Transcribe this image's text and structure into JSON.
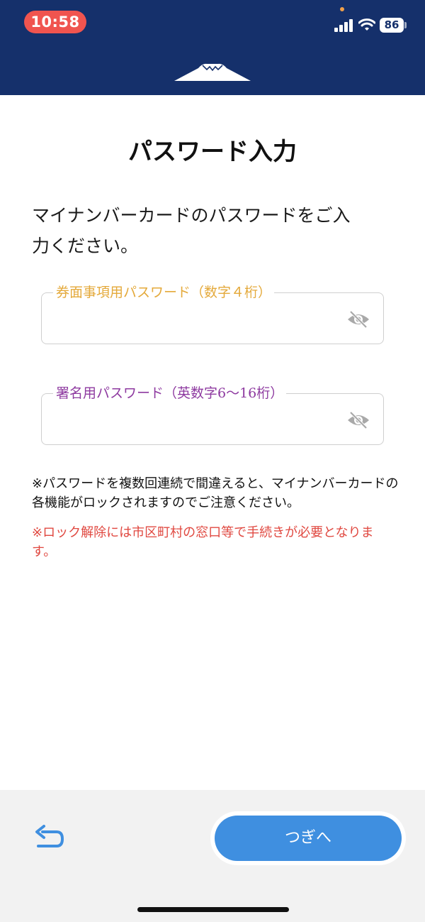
{
  "status_bar": {
    "time": "10:58",
    "battery": "86"
  },
  "page": {
    "title": "パスワード入力",
    "instruction": "マイナンバーカードのパスワードをご入力ください。"
  },
  "fields": [
    {
      "label": "券面事項用パスワード（数字４桁）",
      "value": "",
      "placeholder": "",
      "visibility_icon": "eye-off-icon"
    },
    {
      "label": "署名用パスワード（英数字6〜16桁）",
      "value": "",
      "placeholder": "",
      "visibility_icon": "eye-off-icon"
    }
  ],
  "notes": {
    "warning": "※パスワードを複数回連続で間違えると、マイナンバーカードの各機能がロックされますのでご注意ください。",
    "alert": "※ロック解除には市区町村の窓口等で手続きが必要となります。"
  },
  "footer": {
    "back_icon": "undo-arrow-icon",
    "next_label": "つぎへ"
  },
  "colors": {
    "header_bg": "#15306b",
    "time_pill": "#f0544f",
    "field1_label": "#e4a93a",
    "field2_label": "#8e3aa0",
    "alert_text": "#e04840",
    "next_button": "#3f8fe0",
    "back_icon": "#3f8fe0"
  }
}
